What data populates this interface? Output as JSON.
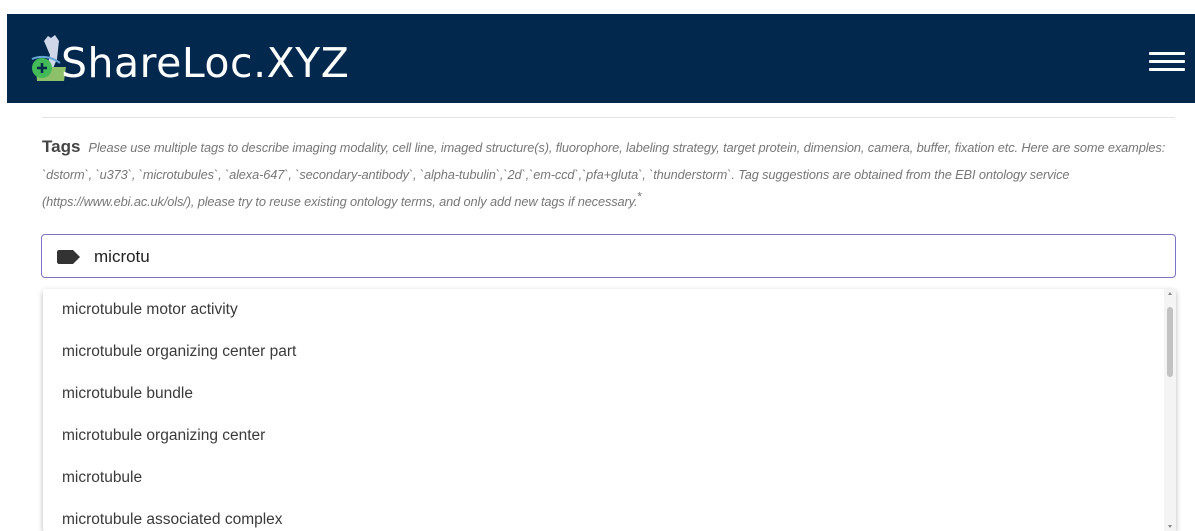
{
  "header": {
    "brand": "ShareLoc.XYZ",
    "logo_icon": "microscope-logo-icon",
    "menu_icon": "hamburger-menu-icon",
    "background_color": "#02284d"
  },
  "tags": {
    "title": "Tags",
    "help_text": "Please use multiple tags to describe imaging modality, cell line, imaged structure(s), fluorophore, labeling strategy, target protein, dimension, camera, buffer, fixation etc. Here are some examples: `dstorm`, `u373`, `microtubules`, `alexa-647`, `secondary-antibody`, `alpha-tubulin`,`2d`,`em-ccd`,`pfa+gluta`, `thunderstorm`. Tag suggestions are obtained from the EBI ontology service (https://www.ebi.ac.uk/ols/), please try to reuse existing ontology terms, and only add new tags if necessary.",
    "required_mark": "*",
    "input_value": "microtu",
    "input_icon": "tag-icon",
    "focus_color": "#7b74c7"
  },
  "suggestions": [
    {
      "label": "microtubule motor activity"
    },
    {
      "label": "microtubule organizing center part"
    },
    {
      "label": "microtubule bundle"
    },
    {
      "label": "microtubule organizing center"
    },
    {
      "label": "microtubule"
    },
    {
      "label": "microtubule associated complex"
    }
  ]
}
